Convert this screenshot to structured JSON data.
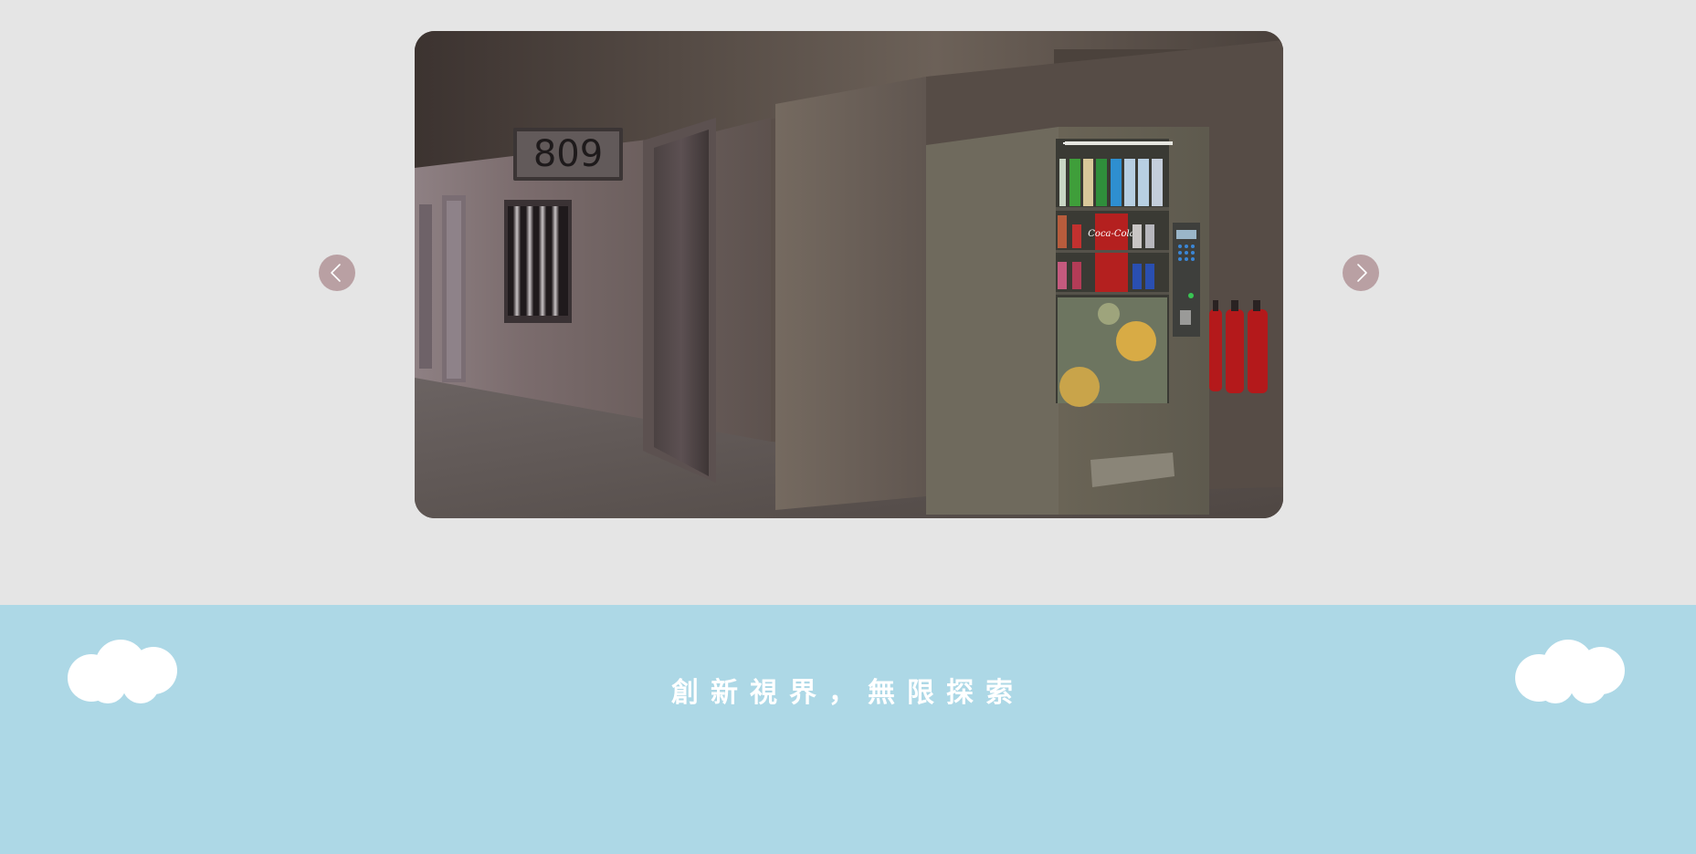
{
  "carousel": {
    "prev_icon": "chevron-left-icon",
    "next_icon": "chevron-right-icon",
    "slide": {
      "room_number": "809",
      "vending_brand": "Coca-Cola"
    },
    "colors": {
      "arrow_bg": "#b9a0a3",
      "page_bg": "#e5e5e5"
    }
  },
  "footer": {
    "tagline": "創新視界，無限探索",
    "colors": {
      "bg": "#add8e6",
      "cloud": "#ffffff",
      "text": "#ffffff"
    }
  }
}
